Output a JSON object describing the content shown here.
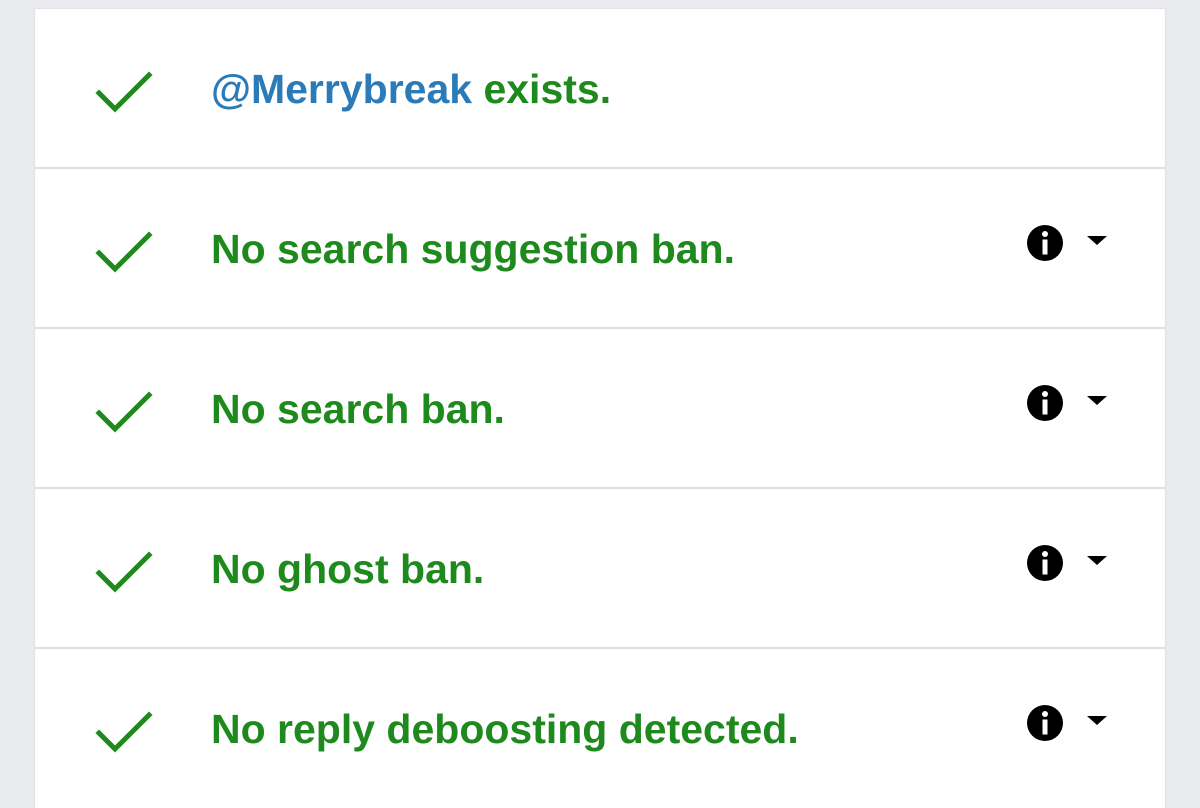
{
  "colors": {
    "success_green": "#1e8a1e",
    "link_blue": "#2b7bb9",
    "icon_black": "#000000",
    "divider": "#dedede",
    "page_background": "#e9ebee"
  },
  "results": [
    {
      "status_icon": "check-icon",
      "handle": "@Merrybreak",
      "text": " exists.",
      "has_details": false
    },
    {
      "status_icon": "check-icon",
      "text": "No search suggestion ban.",
      "has_details": true
    },
    {
      "status_icon": "check-icon",
      "text": "No search ban.",
      "has_details": true
    },
    {
      "status_icon": "check-icon",
      "text": "No ghost ban.",
      "has_details": true
    },
    {
      "status_icon": "check-icon",
      "text": "No reply deboosting detected.",
      "has_details": true
    }
  ]
}
